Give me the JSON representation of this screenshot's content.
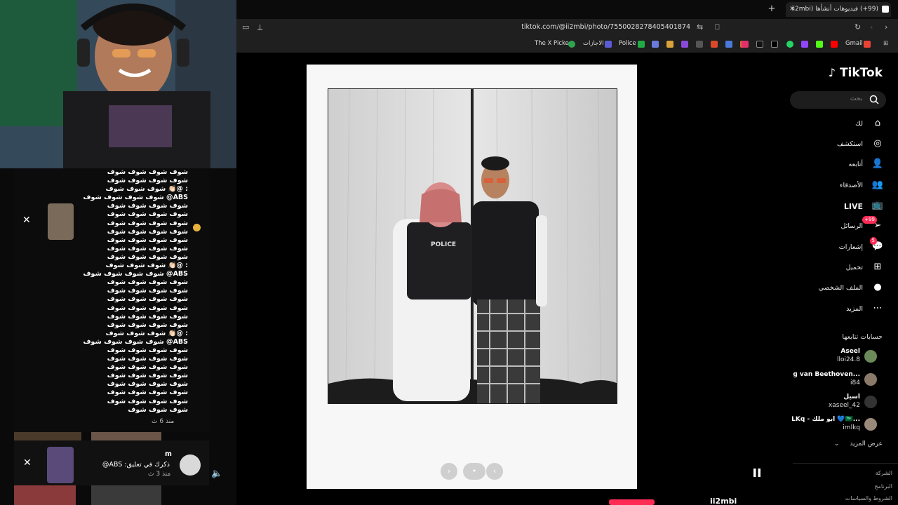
{
  "browser": {
    "tab_title": "(99+) فيديوهات أنشأها (ii2mbi",
    "url": "tiktok.com/@ii2mbi/photo/7550028278405401874",
    "bookmarks": [
      "The X Picker",
      "الاجازات",
      "Police",
      "Gmail"
    ]
  },
  "tiktok": {
    "logo": "TikTok",
    "search_placeholder": "بحث",
    "nav": [
      {
        "label": "لك",
        "icon": "home-icon"
      },
      {
        "label": "استكشف",
        "icon": "compass-icon"
      },
      {
        "label": "أتابعه",
        "icon": "following-icon"
      },
      {
        "label": "الأصدقاء",
        "icon": "friends-icon"
      },
      {
        "label": "LIVE",
        "icon": "live-icon"
      },
      {
        "label": "الرسائل",
        "icon": "messages-icon",
        "badge": "+99"
      },
      {
        "label": "إشعارات",
        "icon": "notifications-icon",
        "badge": "5"
      },
      {
        "label": "تحميل",
        "icon": "upload-icon"
      },
      {
        "label": "الملف الشخصي",
        "icon": "profile-icon"
      },
      {
        "label": "المزيد",
        "icon": "more-icon"
      }
    ],
    "following_title": "حسابات تتابعها",
    "accounts": [
      {
        "name": "Aseel",
        "handle": "lloi24.8"
      },
      {
        "name": "g van Beethoven...",
        "handle": "i84"
      },
      {
        "name": "اسيل",
        "handle": "xaseel_42"
      },
      {
        "name": "LKq - ابو ملك 💙🇸🇦...",
        "handle": "imlkq"
      }
    ],
    "see_more": "عرض المزيد",
    "footer": [
      "الشركة",
      "البرنامج",
      "الشروط والسياسات"
    ],
    "bottom_user": "ii2mbi"
  },
  "post": {
    "vest_text": "POLICE"
  },
  "overlay": {
    "comment_lines": [
      "شوف شوف شوف شوف",
      "شوف شوف شوف شوف",
      ": @👏🏻 شوف شوف شوف",
      "ABS@ شوف شوف شوف شوف",
      "شوف شوف شوف شوف",
      "شوف شوف شوف شوف",
      "شوف شوف شوف شوف",
      "شوف شوف شوف شوف",
      "شوف شوف شوف شوف",
      "شوف شوف شوف شوف",
      "شوف شوف شوف شوف",
      ": @👏🏻 شوف شوف شوف",
      "ABS@ شوف شوف شوف شوف",
      "شوف شوف شوف شوف",
      "شوف شوف شوف شوف",
      "شوف شوف شوف شوف",
      "شوف شوف شوف شوف",
      "شوف شوف شوف شوف",
      "شوف شوف شوف شوف",
      ": @👏🏻 شوف شوف شوف",
      "ABS@ شوف شوف شوف شوف",
      "شوف شوف شوف شوف",
      "شوف شوف شوف شوف",
      "شوف شوف شوف شوف",
      "شوف شوف شوف شوف",
      "شوف شوف شوف شوف",
      "شوف شوف شوف شوف",
      "شوف شوف شوف شوف",
      "شوف شوف شوف"
    ],
    "comment_time": "منذ 6 ث",
    "mention_user": "m",
    "mention_text": "ذكرك في تعليق: ABS@",
    "mention_time": "منذ 3 ث"
  }
}
